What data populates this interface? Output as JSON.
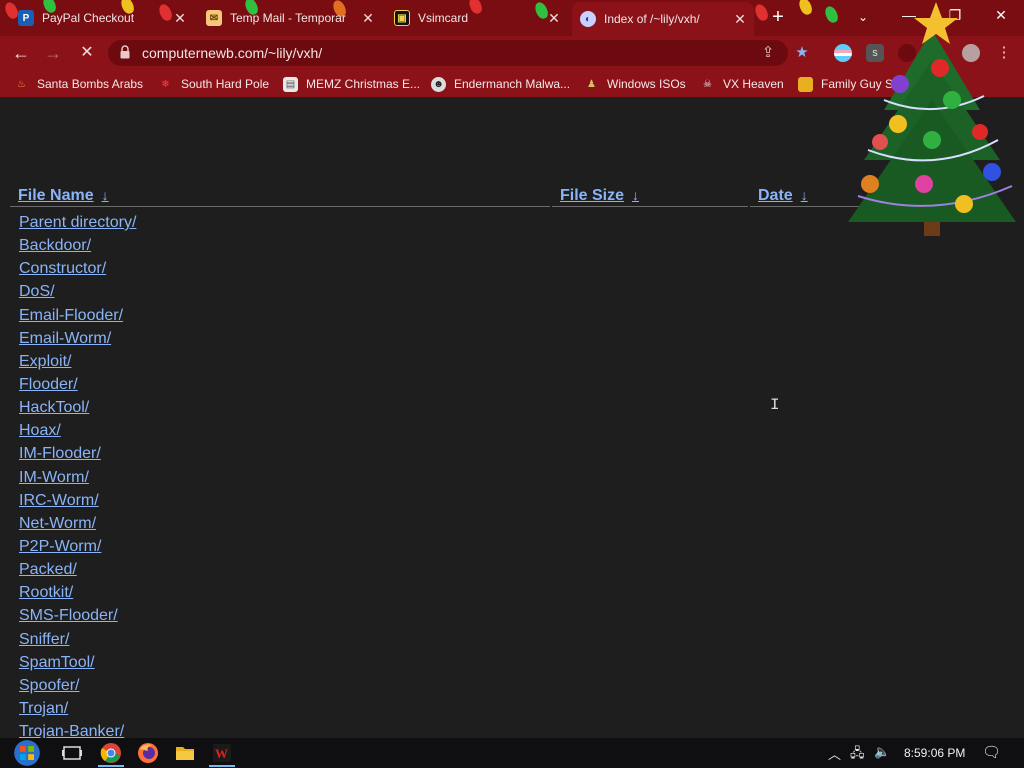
{
  "tabs": [
    {
      "title": "PayPal Checkout",
      "favicon": "paypal-icon",
      "active": false
    },
    {
      "title": "Temp Mail - Temporar",
      "favicon": "mail-envelope-icon",
      "active": false
    },
    {
      "title": "Vsimcard",
      "favicon": "sim-card-icon",
      "active": false
    },
    {
      "title": "Index of /~lily/vxh/",
      "favicon": "globe-icon",
      "active": true
    }
  ],
  "toolbar": {
    "url": "computernewb.com/~lily/vxh/"
  },
  "bookmarks": [
    {
      "label": "Santa Bombs Arabs",
      "icon": "fire-icon"
    },
    {
      "label": "South Hard Pole",
      "icon": "snowflake-icon"
    },
    {
      "label": "MEMZ Christmas E...",
      "icon": "window-icon"
    },
    {
      "label": "Endermanch Malwa...",
      "icon": "mask-icon"
    },
    {
      "label": "Windows ISOs",
      "icon": "figure-icon"
    },
    {
      "label": "VX Heaven",
      "icon": "skull-icon"
    },
    {
      "label": "Family Guy S",
      "icon": "folder-icon"
    }
  ],
  "listing": {
    "headers": {
      "name": "File Name",
      "size": "File Size",
      "date": "Date",
      "sort_arrow": "↓"
    },
    "rows": [
      "Parent directory/",
      "Backdoor/",
      "Constructor/",
      "DoS/",
      "Email-Flooder/",
      "Email-Worm/",
      "Exploit/",
      "Flooder/",
      "HackTool/",
      "Hoax/",
      "IM-Flooder/",
      "IM-Worm/",
      "IRC-Worm/",
      "Net-Worm/",
      "P2P-Worm/",
      "Packed/",
      "Rootkit/",
      "SMS-Flooder/",
      "Sniffer/",
      "SpamTool/",
      "Spoofer/",
      "Trojan/",
      "Trojan-Banker/"
    ]
  },
  "taskbar": {
    "clock": "8:59:06 PM",
    "apps": [
      "start-orb-icon",
      "task-view-icon",
      "chrome-icon",
      "firefox-icon",
      "file-explorer-icon",
      "ollydbg-icon"
    ]
  },
  "colors": {
    "tab_strip": "#7a0d12",
    "toolbar": "#8b1219",
    "page_background": "#1e1e1e",
    "link": "#8ab4f8"
  }
}
